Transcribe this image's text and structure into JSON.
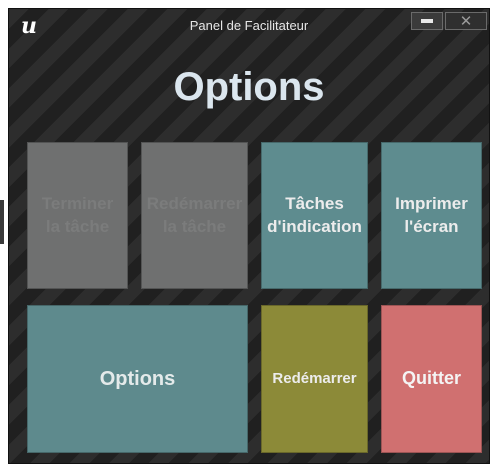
{
  "window": {
    "title": "Panel de Facilitateur",
    "logo_icon": "unreal-logo-icon",
    "logo_glyph": "u"
  },
  "controls": {
    "minimize_icon": "minimize-icon",
    "close_icon": "close-icon",
    "close_glyph": "✕"
  },
  "heading": "Options",
  "tiles": [
    {
      "line1": "Terminer",
      "line2": "la tâche",
      "enabled": false
    },
    {
      "line1": "Redémarrer",
      "line2": "la tâche",
      "enabled": false
    },
    {
      "line1": "Tâches",
      "line2": "d'indication",
      "enabled": true
    },
    {
      "line1": "Imprimer",
      "line2": "l'écran",
      "enabled": true
    },
    {
      "line1": "Options",
      "enabled": true
    },
    {
      "line1": "Redémarrer",
      "enabled": true
    },
    {
      "line1": "Quitter",
      "enabled": true
    }
  ],
  "colors": {
    "disabled": "#6f7070",
    "teal": "#5e8c8f",
    "olive": "#8c8a38",
    "red": "#d07070",
    "background_stripe_dark": "#202020",
    "background_stripe_light": "#2d2d2d"
  }
}
